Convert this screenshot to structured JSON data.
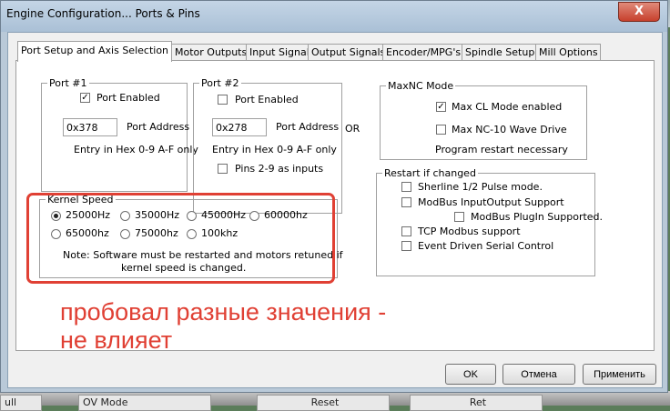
{
  "window": {
    "title": "Engine Configuration... Ports & Pins",
    "close_glyph": "X"
  },
  "tabs": [
    {
      "label": "Port Setup and Axis Selection"
    },
    {
      "label": "Motor Outputs"
    },
    {
      "label": "Input Signals"
    },
    {
      "label": "Output Signals"
    },
    {
      "label": "Encoder/MPG's"
    },
    {
      "label": "Spindle Setup"
    },
    {
      "label": "Mill Options"
    }
  ],
  "port1": {
    "title": "Port #1",
    "enabled_label": "Port Enabled",
    "enabled": true,
    "address": "0x378",
    "address_label": "Port Address",
    "hint": "Entry in Hex 0-9 A-F only"
  },
  "port2": {
    "title": "Port #2",
    "enabled_label": "Port Enabled",
    "enabled": false,
    "address": "0x278",
    "address_label": "Port Address",
    "hint": "Entry in Hex 0-9 A-F only",
    "pins_label": "Pins 2-9 as inputs",
    "pins_checked": false
  },
  "or_label": "OR",
  "maxnc": {
    "title": "MaxNC Mode",
    "cl_label": "Max CL Mode enabled",
    "cl_checked": true,
    "wave_label": "Max NC-10 Wave Drive",
    "wave_checked": false,
    "restart_note": "Program restart necessary"
  },
  "restart": {
    "title": "Restart if changed",
    "items": [
      {
        "label": "Sherline 1/2 Pulse mode.",
        "checked": false
      },
      {
        "label": "ModBus InputOutput Support",
        "checked": false
      },
      {
        "label": "ModBus PlugIn Supported.",
        "checked": false
      },
      {
        "label": "TCP Modbus support",
        "checked": false
      },
      {
        "label": "Event Driven Serial Control",
        "checked": false
      }
    ]
  },
  "kernel": {
    "title": "Kernel Speed",
    "options": [
      "25000Hz",
      "35000Hz",
      "45000Hz",
      "60000hz",
      "65000hz",
      "75000hz",
      "100khz"
    ],
    "selected": "25000Hz",
    "note1": "Note: Software must be restarted and motors retuned if",
    "note2": "kernel speed is changed."
  },
  "annotation": {
    "line1": "пробовал разные значения -",
    "line2": "не влияет",
    "color": "#e04034"
  },
  "buttons": {
    "ok": "OK",
    "cancel": "Отмена",
    "apply": "Применить"
  },
  "taskbar": {
    "seg1": "ull",
    "seg2": "OV Mode",
    "seg3": "Reset",
    "seg4": "Ret"
  }
}
